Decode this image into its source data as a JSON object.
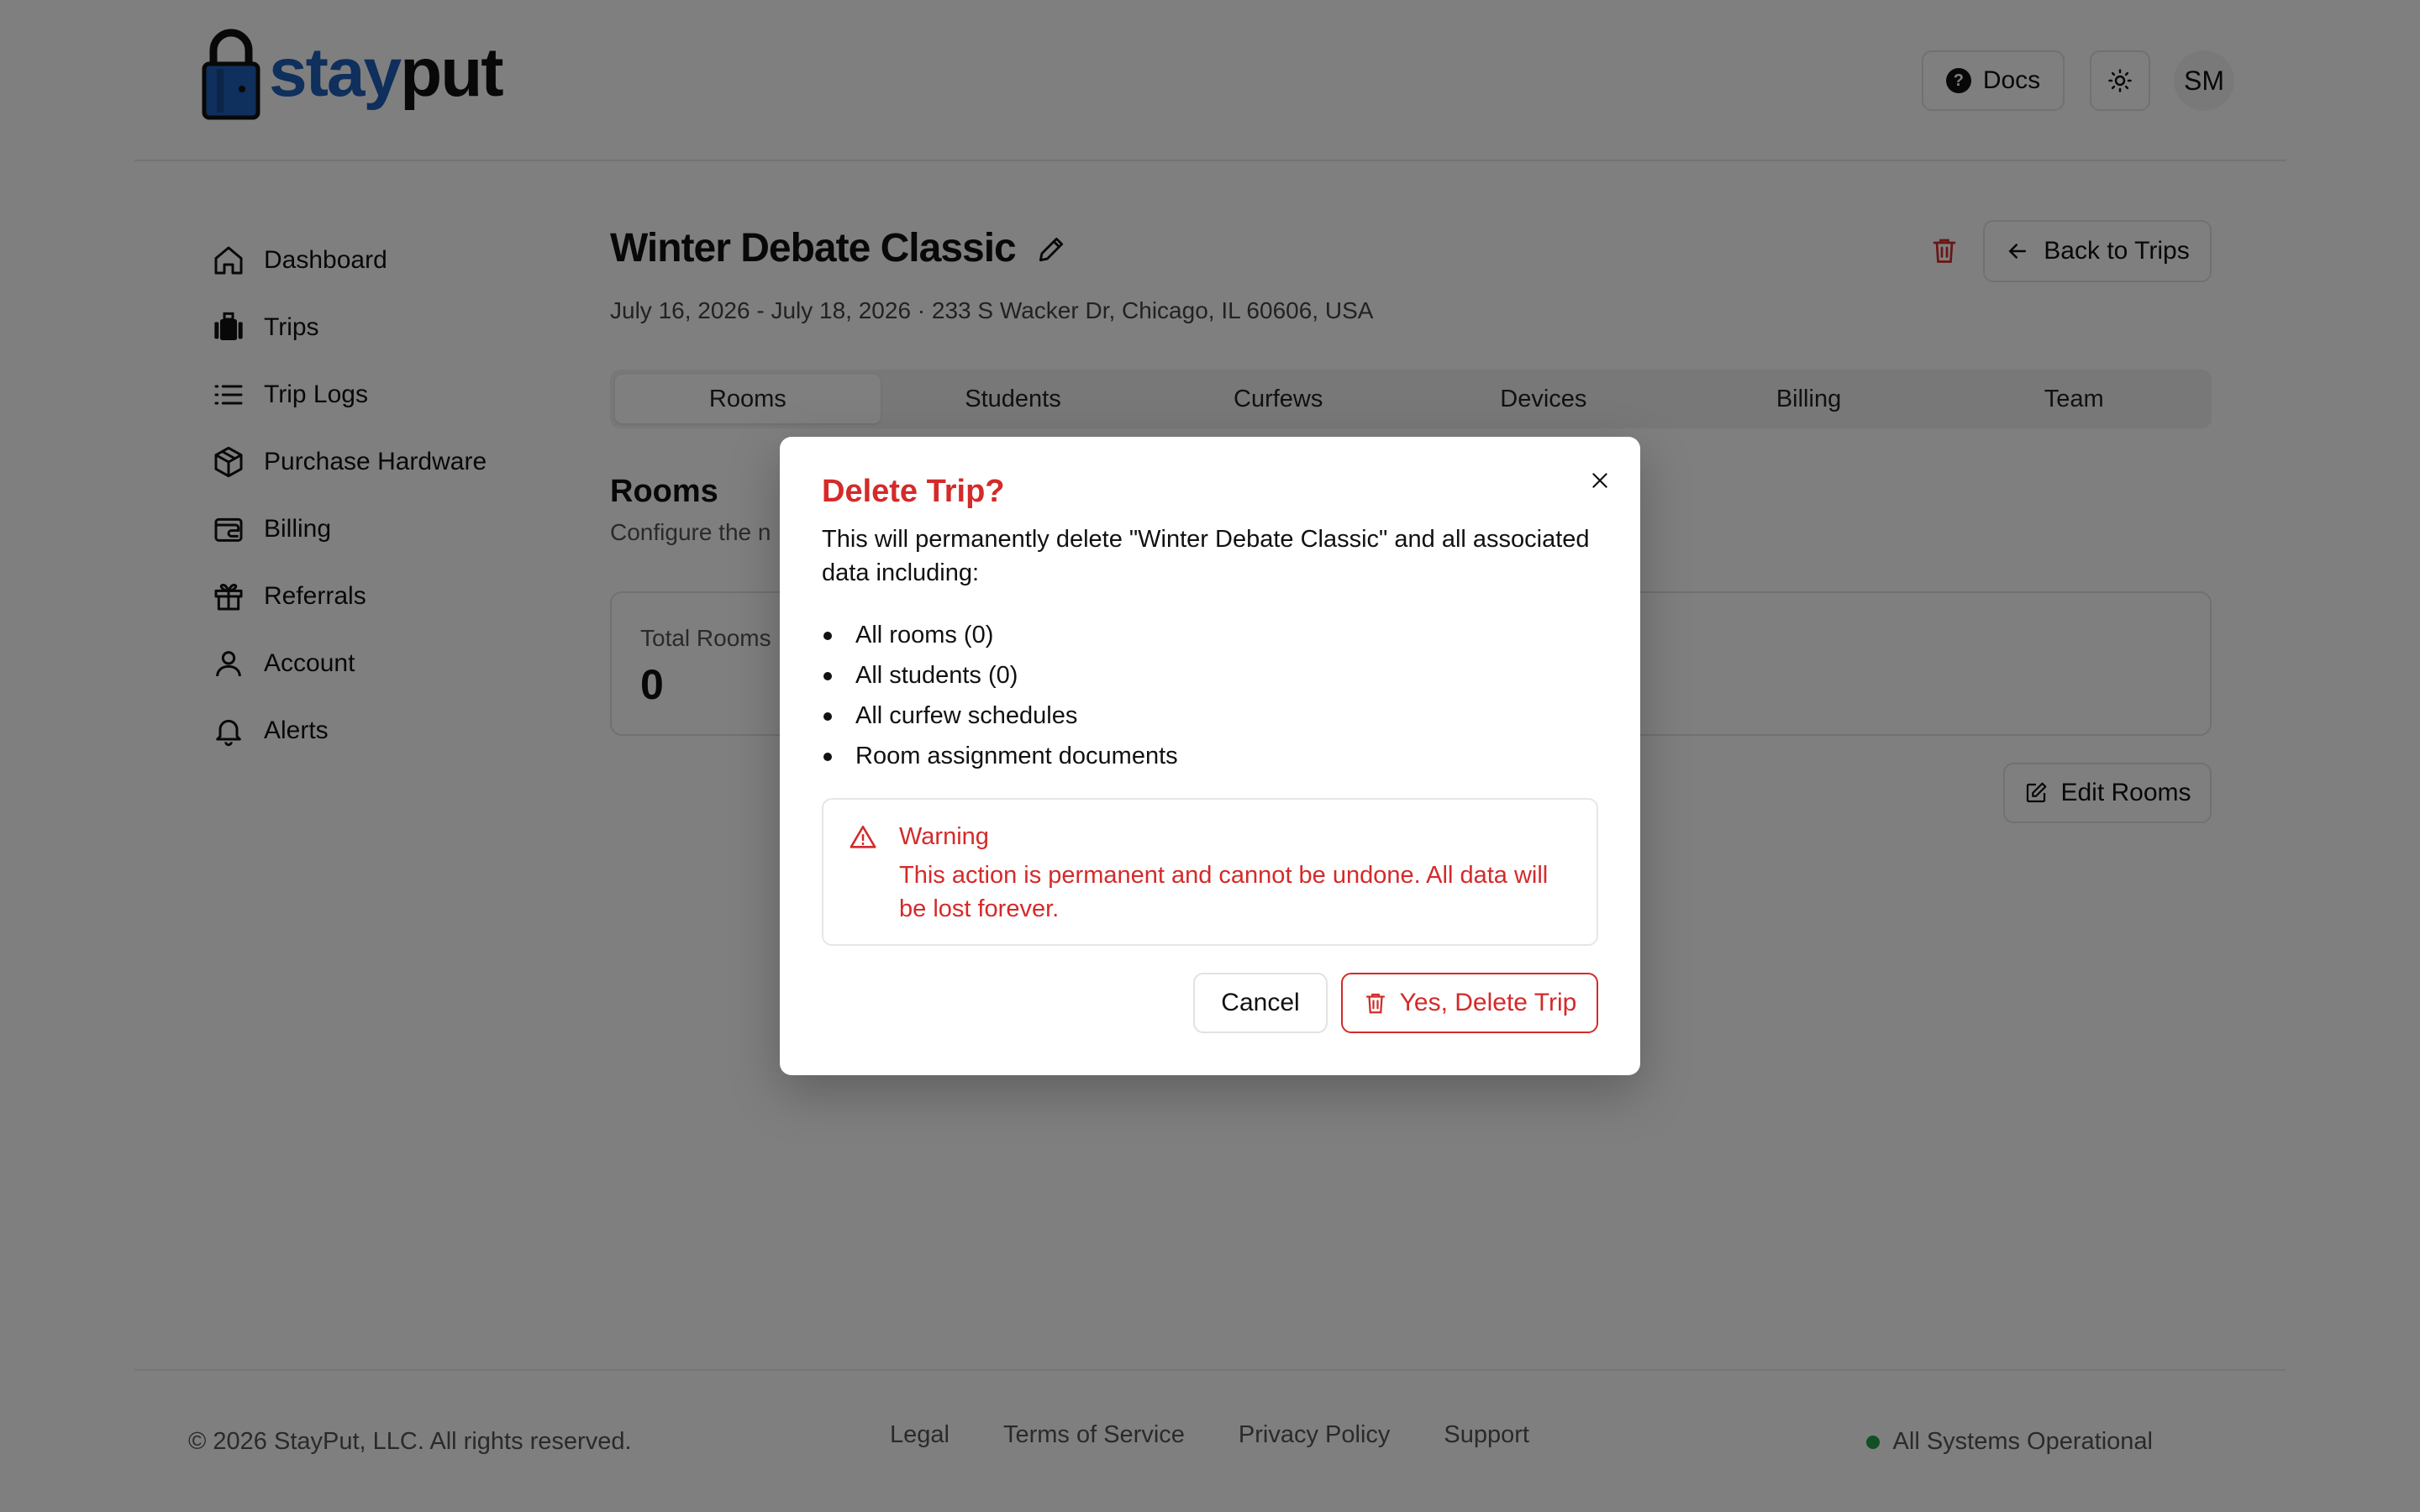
{
  "brand": {
    "name_part1": "stay",
    "name_part2": "put",
    "accent": "#1f5fb8"
  },
  "header": {
    "docs_label": "Docs",
    "avatar_initials": "SM"
  },
  "sidebar": {
    "items": [
      {
        "label": "Dashboard",
        "icon": "home-icon"
      },
      {
        "label": "Trips",
        "icon": "luggage-icon"
      },
      {
        "label": "Trip Logs",
        "icon": "list-icon"
      },
      {
        "label": "Purchase Hardware",
        "icon": "package-icon"
      },
      {
        "label": "Billing",
        "icon": "wallet-icon"
      },
      {
        "label": "Referrals",
        "icon": "gift-icon"
      },
      {
        "label": "Account",
        "icon": "user-icon"
      },
      {
        "label": "Alerts",
        "icon": "bell-icon"
      }
    ]
  },
  "trip": {
    "title": "Winter Debate Classic",
    "meta": "July 16, 2026 - July 18, 2026 · 233 S Wacker Dr, Chicago, IL 60606, USA",
    "back_label": "Back to Trips"
  },
  "tabs": [
    {
      "label": "Rooms",
      "active": true
    },
    {
      "label": "Students",
      "active": false
    },
    {
      "label": "Curfews",
      "active": false
    },
    {
      "label": "Devices",
      "active": false
    },
    {
      "label": "Billing",
      "active": false
    },
    {
      "label": "Team",
      "active": false
    }
  ],
  "rooms_section": {
    "title": "Rooms",
    "subtitle": "Configure the n",
    "total_rooms_label": "Total Rooms",
    "total_rooms_value": "0",
    "edit_rooms_label": "Edit Rooms"
  },
  "footer": {
    "copyright": "© 2026 StayPut, LLC. All rights reserved.",
    "links": [
      "Legal",
      "Terms of Service",
      "Privacy Policy",
      "Support"
    ],
    "status": "All Systems Operational",
    "status_color": "#22a04b"
  },
  "modal": {
    "title": "Delete Trip?",
    "description": "This will permanently delete \"Winter Debate Classic\" and all associated data including:",
    "items": [
      "All rooms (0)",
      "All students (0)",
      "All curfew schedules",
      "Room assignment documents"
    ],
    "warning_title": "Warning",
    "warning_text": "This action is permanent and cannot be undone. All data will be lost forever.",
    "cancel_label": "Cancel",
    "confirm_label": "Yes, Delete Trip",
    "danger_color": "#d42a2a"
  }
}
